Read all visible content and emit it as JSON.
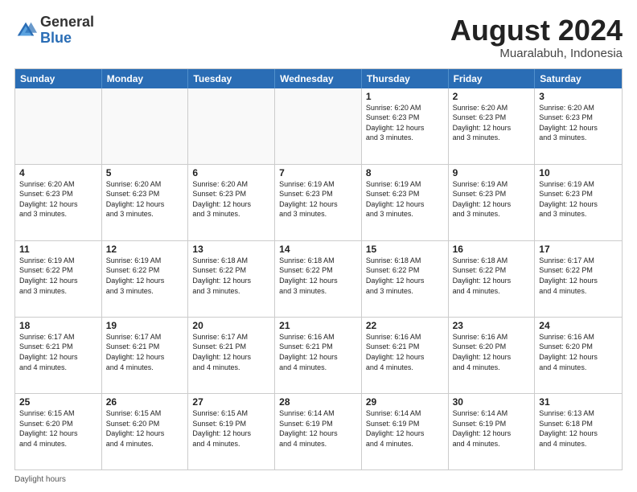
{
  "header": {
    "logo_line1": "General",
    "logo_line2": "Blue",
    "month_year": "August 2024",
    "location": "Muaralabuh, Indonesia"
  },
  "day_names": [
    "Sunday",
    "Monday",
    "Tuesday",
    "Wednesday",
    "Thursday",
    "Friday",
    "Saturday"
  ],
  "footer": {
    "daylight_hours_label": "Daylight hours"
  },
  "weeks": [
    [
      {
        "num": "",
        "info": "",
        "empty": true
      },
      {
        "num": "",
        "info": "",
        "empty": true
      },
      {
        "num": "",
        "info": "",
        "empty": true
      },
      {
        "num": "",
        "info": "",
        "empty": true
      },
      {
        "num": "1",
        "info": "Sunrise: 6:20 AM\nSunset: 6:23 PM\nDaylight: 12 hours\nand 3 minutes."
      },
      {
        "num": "2",
        "info": "Sunrise: 6:20 AM\nSunset: 6:23 PM\nDaylight: 12 hours\nand 3 minutes."
      },
      {
        "num": "3",
        "info": "Sunrise: 6:20 AM\nSunset: 6:23 PM\nDaylight: 12 hours\nand 3 minutes."
      }
    ],
    [
      {
        "num": "4",
        "info": "Sunrise: 6:20 AM\nSunset: 6:23 PM\nDaylight: 12 hours\nand 3 minutes."
      },
      {
        "num": "5",
        "info": "Sunrise: 6:20 AM\nSunset: 6:23 PM\nDaylight: 12 hours\nand 3 minutes."
      },
      {
        "num": "6",
        "info": "Sunrise: 6:20 AM\nSunset: 6:23 PM\nDaylight: 12 hours\nand 3 minutes."
      },
      {
        "num": "7",
        "info": "Sunrise: 6:19 AM\nSunset: 6:23 PM\nDaylight: 12 hours\nand 3 minutes."
      },
      {
        "num": "8",
        "info": "Sunrise: 6:19 AM\nSunset: 6:23 PM\nDaylight: 12 hours\nand 3 minutes."
      },
      {
        "num": "9",
        "info": "Sunrise: 6:19 AM\nSunset: 6:23 PM\nDaylight: 12 hours\nand 3 minutes."
      },
      {
        "num": "10",
        "info": "Sunrise: 6:19 AM\nSunset: 6:23 PM\nDaylight: 12 hours\nand 3 minutes."
      }
    ],
    [
      {
        "num": "11",
        "info": "Sunrise: 6:19 AM\nSunset: 6:22 PM\nDaylight: 12 hours\nand 3 minutes."
      },
      {
        "num": "12",
        "info": "Sunrise: 6:19 AM\nSunset: 6:22 PM\nDaylight: 12 hours\nand 3 minutes."
      },
      {
        "num": "13",
        "info": "Sunrise: 6:18 AM\nSunset: 6:22 PM\nDaylight: 12 hours\nand 3 minutes."
      },
      {
        "num": "14",
        "info": "Sunrise: 6:18 AM\nSunset: 6:22 PM\nDaylight: 12 hours\nand 3 minutes."
      },
      {
        "num": "15",
        "info": "Sunrise: 6:18 AM\nSunset: 6:22 PM\nDaylight: 12 hours\nand 3 minutes."
      },
      {
        "num": "16",
        "info": "Sunrise: 6:18 AM\nSunset: 6:22 PM\nDaylight: 12 hours\nand 4 minutes."
      },
      {
        "num": "17",
        "info": "Sunrise: 6:17 AM\nSunset: 6:22 PM\nDaylight: 12 hours\nand 4 minutes."
      }
    ],
    [
      {
        "num": "18",
        "info": "Sunrise: 6:17 AM\nSunset: 6:21 PM\nDaylight: 12 hours\nand 4 minutes."
      },
      {
        "num": "19",
        "info": "Sunrise: 6:17 AM\nSunset: 6:21 PM\nDaylight: 12 hours\nand 4 minutes."
      },
      {
        "num": "20",
        "info": "Sunrise: 6:17 AM\nSunset: 6:21 PM\nDaylight: 12 hours\nand 4 minutes."
      },
      {
        "num": "21",
        "info": "Sunrise: 6:16 AM\nSunset: 6:21 PM\nDaylight: 12 hours\nand 4 minutes."
      },
      {
        "num": "22",
        "info": "Sunrise: 6:16 AM\nSunset: 6:21 PM\nDaylight: 12 hours\nand 4 minutes."
      },
      {
        "num": "23",
        "info": "Sunrise: 6:16 AM\nSunset: 6:20 PM\nDaylight: 12 hours\nand 4 minutes."
      },
      {
        "num": "24",
        "info": "Sunrise: 6:16 AM\nSunset: 6:20 PM\nDaylight: 12 hours\nand 4 minutes."
      }
    ],
    [
      {
        "num": "25",
        "info": "Sunrise: 6:15 AM\nSunset: 6:20 PM\nDaylight: 12 hours\nand 4 minutes."
      },
      {
        "num": "26",
        "info": "Sunrise: 6:15 AM\nSunset: 6:20 PM\nDaylight: 12 hours\nand 4 minutes."
      },
      {
        "num": "27",
        "info": "Sunrise: 6:15 AM\nSunset: 6:19 PM\nDaylight: 12 hours\nand 4 minutes."
      },
      {
        "num": "28",
        "info": "Sunrise: 6:14 AM\nSunset: 6:19 PM\nDaylight: 12 hours\nand 4 minutes."
      },
      {
        "num": "29",
        "info": "Sunrise: 6:14 AM\nSunset: 6:19 PM\nDaylight: 12 hours\nand 4 minutes."
      },
      {
        "num": "30",
        "info": "Sunrise: 6:14 AM\nSunset: 6:19 PM\nDaylight: 12 hours\nand 4 minutes."
      },
      {
        "num": "31",
        "info": "Sunrise: 6:13 AM\nSunset: 6:18 PM\nDaylight: 12 hours\nand 4 minutes."
      }
    ]
  ]
}
